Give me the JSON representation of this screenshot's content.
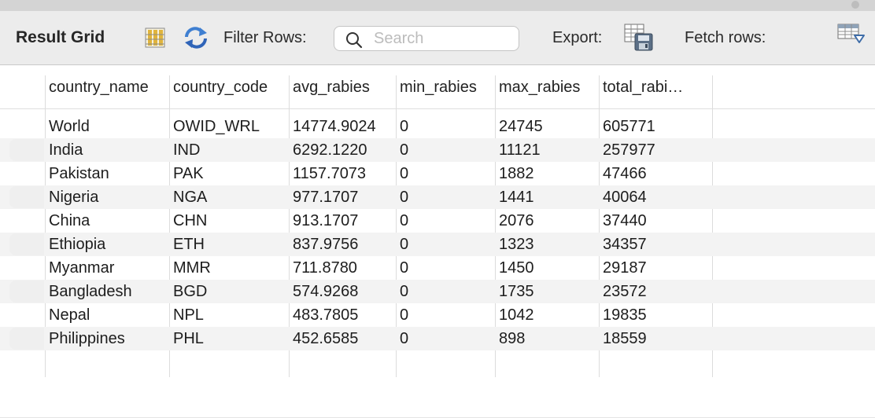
{
  "toolbar": {
    "title": "Result Grid",
    "filter_label": "Filter Rows:",
    "search_placeholder": "Search",
    "export_label": "Export:",
    "fetch_label": "Fetch rows:"
  },
  "icons": {
    "grid_toggle": "grid-layout-icon",
    "refresh": "refresh-icon",
    "search": "search-icon",
    "export": "export-save-icon",
    "fetch": "fetch-rows-icon"
  },
  "colors": {
    "toolbar_bg": "#ececec",
    "grid_icon": "#e0b43c",
    "refresh_icon": "#3f7fd1",
    "alt_row": "#f3f3f3"
  },
  "columns": [
    "country_name",
    "country_code",
    "avg_rabies",
    "min_rabies",
    "max_rabies",
    "total_rabi…"
  ],
  "rows": [
    [
      "World",
      "OWID_WRL",
      "14774.9024",
      "0",
      "24745",
      "605771"
    ],
    [
      "India",
      "IND",
      "6292.1220",
      "0",
      "11121",
      "257977"
    ],
    [
      "Pakistan",
      "PAK",
      "1157.7073",
      "0",
      "1882",
      "47466"
    ],
    [
      "Nigeria",
      "NGA",
      "977.1707",
      "0",
      "1441",
      "40064"
    ],
    [
      "China",
      "CHN",
      "913.1707",
      "0",
      "2076",
      "37440"
    ],
    [
      "Ethiopia",
      "ETH",
      "837.9756",
      "0",
      "1323",
      "34357"
    ],
    [
      "Myanmar",
      "MMR",
      "711.8780",
      "0",
      "1450",
      "29187"
    ],
    [
      "Bangladesh",
      "BGD",
      "574.9268",
      "0",
      "1735",
      "23572"
    ],
    [
      "Nepal",
      "NPL",
      "483.7805",
      "0",
      "1042",
      "19835"
    ],
    [
      "Philippines",
      "PHL",
      "452.6585",
      "0",
      "898",
      "18559"
    ]
  ]
}
